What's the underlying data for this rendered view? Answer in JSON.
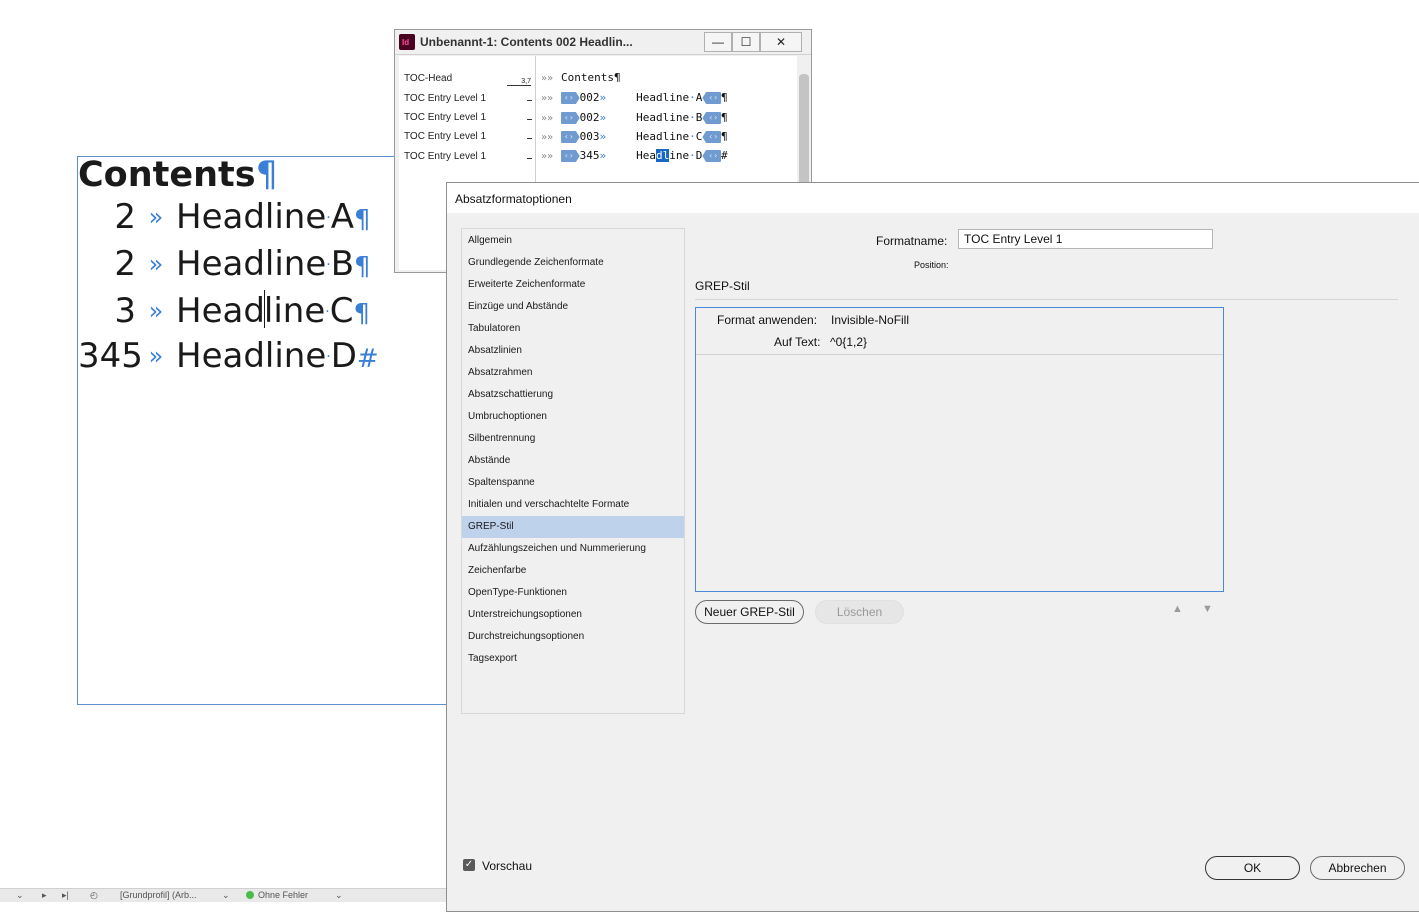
{
  "document": {
    "title": "Contents",
    "pilcrow": "¶",
    "entries": [
      {
        "num": "2",
        "tab": "»",
        "headline": "Headline",
        "letter": "A",
        "end": "¶"
      },
      {
        "num": "2",
        "tab": "»",
        "headline": "Headline",
        "letter": "B",
        "end": "¶"
      },
      {
        "num": "3",
        "tab": "»",
        "headline": "Headline",
        "letter": "C",
        "end": "¶"
      },
      {
        "num": "345",
        "tab": "»",
        "headline": "Headline",
        "letter": "D",
        "end": "#"
      }
    ]
  },
  "story_editor": {
    "title": "Unbenannt-1: Contents 002 Headlin...",
    "buttons": {
      "minimize": "—",
      "maximize": "☐",
      "close": "✕"
    },
    "styles": [
      {
        "name": "TOC-Head",
        "depth": "3,7"
      },
      {
        "name": "TOC Entry Level 1",
        "depth": ""
      },
      {
        "name": "TOC Entry Level 1",
        "depth": ""
      },
      {
        "name": "TOC Entry Level 1",
        "depth": ""
      },
      {
        "name": "TOC Entry Level 1",
        "depth": ""
      }
    ],
    "lines": [
      {
        "chev": "»»",
        "text": "Contents",
        "end": "¶"
      },
      {
        "chev": "»»",
        "num": "002",
        "headline": "Headline",
        "letter": "A",
        "end": "¶"
      },
      {
        "chev": "»»",
        "num": "002",
        "headline": "Headline",
        "letter": "B",
        "end": "¶"
      },
      {
        "chev": "»»",
        "num": "003",
        "headline": "Headline",
        "letter": "C",
        "end": "¶"
      },
      {
        "chev": "»»",
        "num": "345",
        "headline_a": "Hea",
        "headline_sel": "dl",
        "headline_b": "ine",
        "letter": "D",
        "end": "#"
      }
    ],
    "tag_label": "‹›",
    "tab_glyph": "»"
  },
  "dialog": {
    "title": "Absatzformatoptionen",
    "categories": [
      "Allgemein",
      "Grundlegende Zeichenformate",
      "Erweiterte Zeichenformate",
      "Einzüge und Abstände",
      "Tabulatoren",
      "Absatzlinien",
      "Absatzrahmen",
      "Absatzschattierung",
      "Umbruchoptionen",
      "Silbentrennung",
      "Abstände",
      "Spaltenspanne",
      "Initialen und verschachtelte Formate",
      "GREP-Stil",
      "Aufzählungszeichen und Nummerierung",
      "Zeichenfarbe",
      "OpenType-Funktionen",
      "Unterstreichungsoptionen",
      "Durchstreichungsoptionen",
      "Tagsexport"
    ],
    "selected_category": "GREP-Stil",
    "format_name_label": "Formatname:",
    "format_name_value": "TOC Entry Level 1",
    "position_label": "Position:",
    "section_title": "GREP-Stil",
    "grep": {
      "apply_label": "Format anwenden:",
      "apply_value": "Invisible-NoFill",
      "text_label": "Auf Text:",
      "text_value": "^0{1,2}"
    },
    "new_grep_button": "Neuer GREP-Stil",
    "delete_button": "Löschen",
    "up_arrow": "▲",
    "down_arrow": "▼",
    "preview_label": "Vorschau",
    "preview_checked": true,
    "ok_button": "OK",
    "cancel_button": "Abbrechen"
  },
  "status_bar": {
    "profile": "[Grundprofil] (Arb...",
    "errors": "Ohne Fehler"
  }
}
